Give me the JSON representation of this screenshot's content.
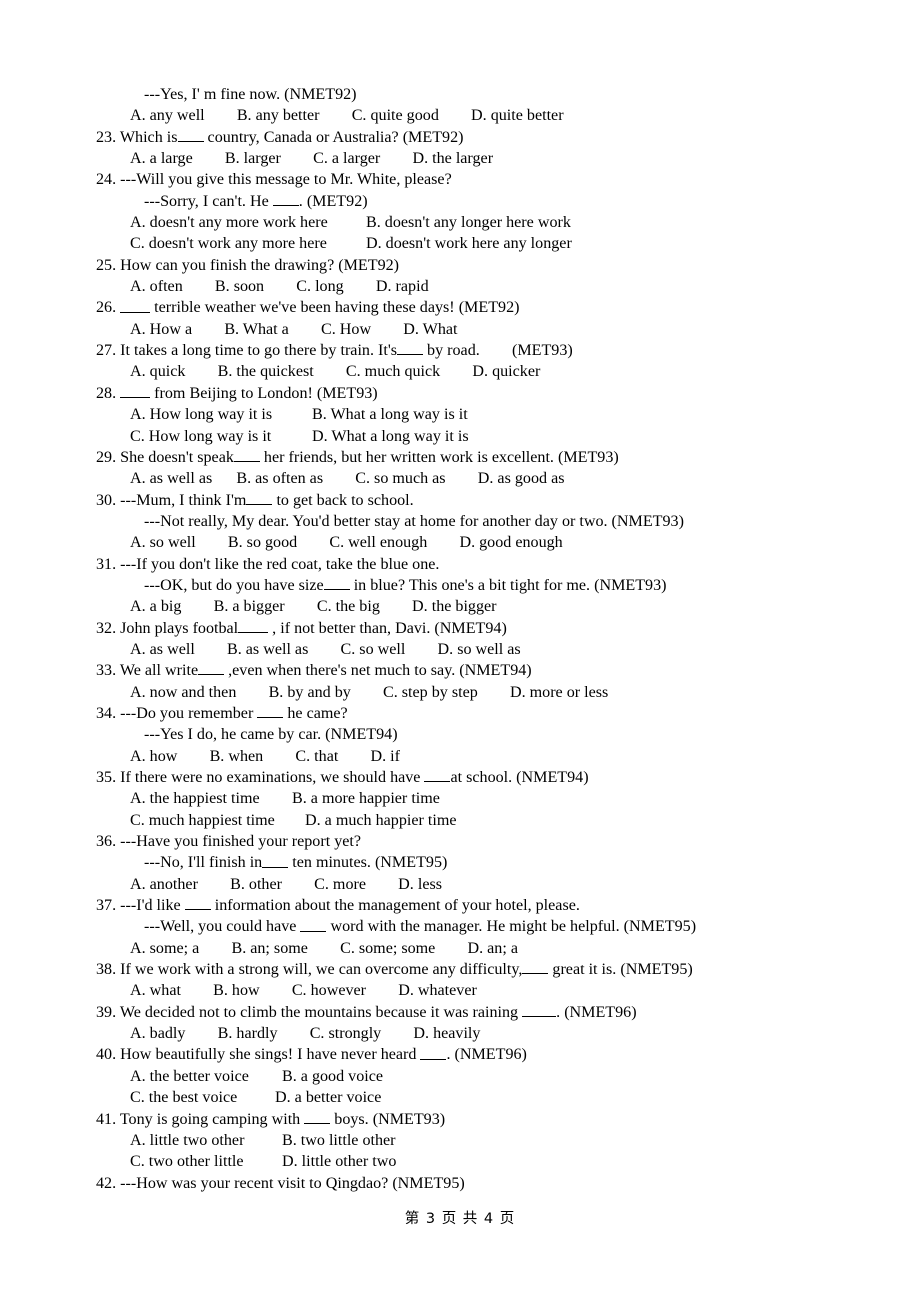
{
  "document": {
    "page_footer": "第 3 页 共 4 页",
    "page_number": "3",
    "total_pages": "4"
  },
  "questions": [
    {
      "id": "q22",
      "stem_continuation": "---Yes, I' m fine now. (NMET92)",
      "options_line": "A. any well        B. any better        C. quite good        D. quite better"
    },
    {
      "id": "q23",
      "number": "23.",
      "stem_pre": "23. Which is",
      "stem_post": "country, Canada or Australia? (MET92)",
      "options_line": "A. a large        B. larger        C. a larger        D. the larger"
    },
    {
      "id": "q24",
      "stem": "24. ---Will you give this message to Mr. White, please?",
      "reply_pre": "---Sorry, I can't. He ",
      "reply_post": ". (MET92)",
      "opt_a": "A. doesn't any more work here",
      "opt_b": "B. doesn't any longer here work",
      "opt_c": "C. doesn't work any more here",
      "opt_d": "D. doesn't work here any longer"
    },
    {
      "id": "q25",
      "stem": "25. How can you finish the drawing? (MET92)",
      "options_line": "A. often        B. soon        C. long        D. rapid"
    },
    {
      "id": "q26",
      "stem_pre": "26. ",
      "stem_post": " terrible weather we've been having these days! (MET92)",
      "options_line": "A. How a        B. What a        C. How        D. What"
    },
    {
      "id": "q27",
      "stem_pre": "27. It takes a long time to go there by train. It's",
      "stem_post": " by road.        (MET93)",
      "options_line": "A. quick        B. the quickest        C. much quick        D. quicker"
    },
    {
      "id": "q28",
      "stem_pre": "28. ",
      "stem_post": " from Beijing to London! (MET93)",
      "opt_a": "A. How long way it is",
      "opt_b": "B. What a long way is it",
      "opt_c": "C. How long way is it",
      "opt_d": "D. What a long way it is"
    },
    {
      "id": "q29",
      "stem_pre": "29. She doesn't speak",
      "stem_post": " her friends, but her written work is excellent. (MET93)",
      "options_line": "A. as well as      B. as often as        C. so much as        D. as good as"
    },
    {
      "id": "q30",
      "stem_pre": "30. ---Mum, I think I'm",
      "stem_post": " to get back to school.",
      "reply": "---Not really, My dear. You'd better stay at home for another day or two. (NMET93)",
      "options_line": "A. so well        B. so good        C. well enough        D. good enough"
    },
    {
      "id": "q31",
      "stem": "31. ---If you don't like the red coat, take the blue one.",
      "reply_pre": "---OK, but do you have size",
      "reply_post": " in blue? This one's a bit tight for me. (NMET93)",
      "options_line": "A. a big        B. a bigger        C. the big        D. the bigger"
    },
    {
      "id": "q32",
      "stem_pre": "32. John plays footbal",
      "stem_post": " , if not better than, Davi. (NMET94)",
      "options_line": "A. as well        B. as well as        C. so well        D. so well as"
    },
    {
      "id": "q33",
      "stem_pre": "33. We all write",
      "stem_post": " ,even when there's net much to say. (NMET94)",
      "options_line": "A. now and then        B. by and by        C. step by step        D. more or less"
    },
    {
      "id": "q34",
      "stem_pre": "34. ---Do you remember ",
      "stem_post": " he came?",
      "reply": "---Yes I do, he came by car. (NMET94)",
      "options_line": "A. how        B. when        C. that        D. if"
    },
    {
      "id": "q35",
      "stem_pre": "35. If there were no examinations, we should have ",
      "stem_post": "at school. (NMET94)",
      "opt_a": "A. the happiest time",
      "opt_b": "B. a more happier time",
      "opt_c": "C. much happiest time",
      "opt_d": "D. a much happier time"
    },
    {
      "id": "q36",
      "stem": "36. ---Have you finished your report yet?",
      "reply_pre": "---No, I'll finish in",
      "reply_post": " ten minutes. (NMET95)",
      "options_line": "A. another        B. other        C. more        D. less"
    },
    {
      "id": "q37",
      "stem_pre": "37. ---I'd like ",
      "stem_post": " information about the management of your hotel, please.",
      "reply_pre": "---Well, you could have ",
      "reply_post": " word with the manager. He might be helpful. (NMET95)",
      "options_line": "A. some; a        B. an; some        C. some; some        D. an; a"
    },
    {
      "id": "q38",
      "stem_pre": "38. If we work with a strong will, we can overcome any difficulty,",
      "stem_post": " great it is. (NMET95)",
      "options_line": "A. what        B. how        C. however        D. whatever"
    },
    {
      "id": "q39",
      "stem_pre": "39. We decided not to climb the mountains because it was raining ",
      "stem_post": ". (NMET96)",
      "options_line": "A. badly        B. hardly        C. strongly        D. heavily"
    },
    {
      "id": "q40",
      "stem_pre": "40. How beautifully she sings! I have never heard ",
      "stem_post": ". (NMET96)",
      "opt_a": "A. the better voice",
      "opt_b": "B. a good voice",
      "opt_c": "C. the best voice",
      "opt_d": "D. a better voice"
    },
    {
      "id": "q41",
      "stem_pre": "41. Tony is going camping with ",
      "stem_post": " boys. (NMET93)",
      "opt_a": "A. little two other",
      "opt_b": "B. two little other",
      "opt_c": "C. two other little",
      "opt_d": "D. little other two"
    },
    {
      "id": "q42",
      "stem": "42. ---How was your recent visit to Qingdao? (NMET95)"
    }
  ]
}
